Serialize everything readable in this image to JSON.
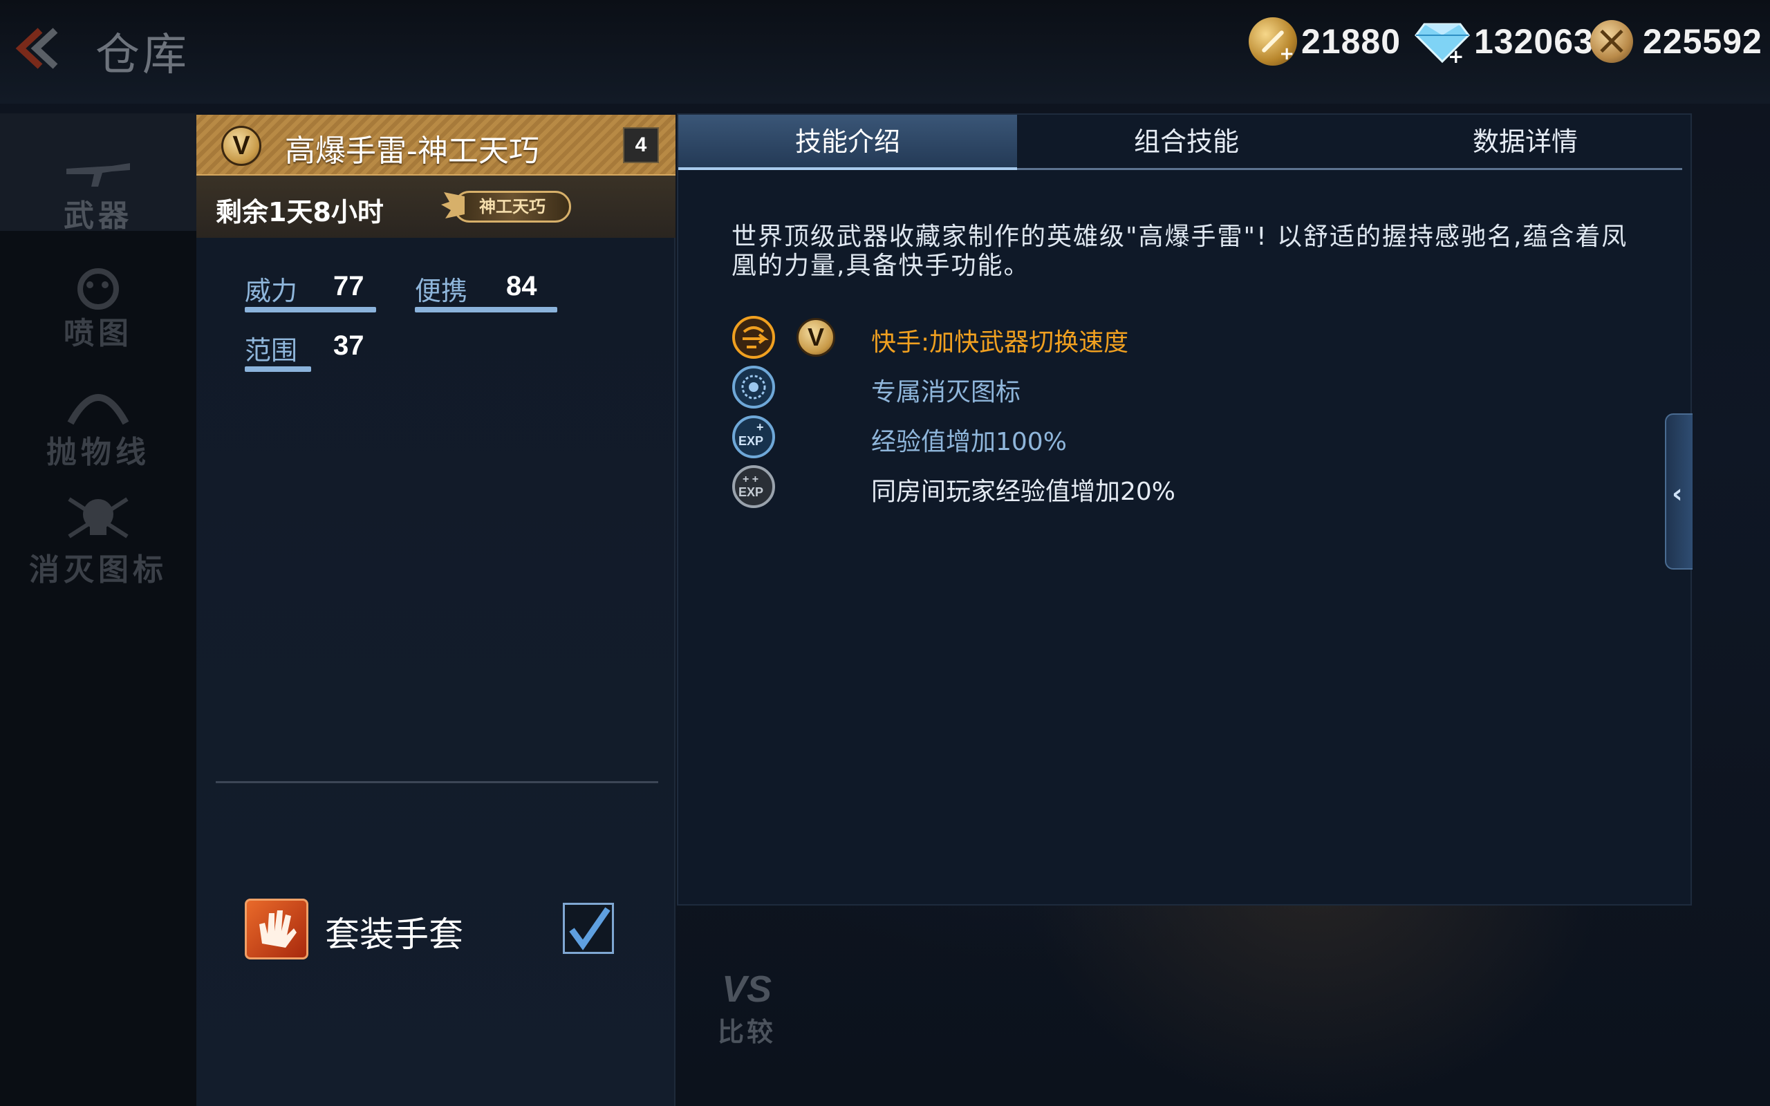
{
  "header": {
    "title": "仓库",
    "currencies": [
      {
        "icon": "gold-coin-icon",
        "value": "21880"
      },
      {
        "icon": "diamond-icon",
        "value": "132063"
      },
      {
        "icon": "medal-icon",
        "value": "225592"
      }
    ]
  },
  "sidebar": {
    "items": [
      {
        "label": "武器",
        "icon": "rifle-icon",
        "active": true
      },
      {
        "label": "喷图",
        "icon": "spray-icon",
        "active": false
      },
      {
        "label": "抛物线",
        "icon": "parabola-icon",
        "active": false
      },
      {
        "label": "消灭图标",
        "icon": "skull-icon",
        "active": false
      }
    ]
  },
  "weapon": {
    "badge": "V",
    "name": "高爆手雷-神工天巧",
    "level": "4",
    "remaining": "剩余1天8小时",
    "tag": "神工天巧",
    "stats": [
      {
        "name": "威力",
        "value": "77"
      },
      {
        "name": "便携",
        "value": "84"
      },
      {
        "name": "范围",
        "value": "37"
      }
    ],
    "suit": {
      "label": "套装手套",
      "checked": true
    }
  },
  "panel": {
    "tabs": [
      {
        "label": "技能介绍",
        "active": true
      },
      {
        "label": "组合技能",
        "active": false
      },
      {
        "label": "数据详情",
        "active": false
      }
    ],
    "description": "世界顶级武器收藏家制作的英雄级\"高爆手雷\"! 以舒适的握持感驰名,蕴含着凤凰的力量,具备快手功能。",
    "skills": [
      {
        "icon": "quick-hand-icon",
        "badge": "V",
        "text": "快手:加快武器切换速度",
        "color": "#f0a020"
      },
      {
        "icon": "kill-mark-icon",
        "text": "专属消灭图标",
        "color": "#8fb6db"
      },
      {
        "icon": "exp-boost-icon",
        "text": "经验值增加100%",
        "color": "#8fb6db"
      },
      {
        "icon": "room-exp-icon",
        "text": "同房间玩家经验值增加20%",
        "color": "#e6ecf4"
      }
    ]
  },
  "compare": {
    "vs": "VS",
    "label": "比较"
  },
  "colors": {
    "accent_gold": "#b88a45",
    "accent_blue": "#8bb3dc",
    "skill_highlight": "#f0a020"
  }
}
